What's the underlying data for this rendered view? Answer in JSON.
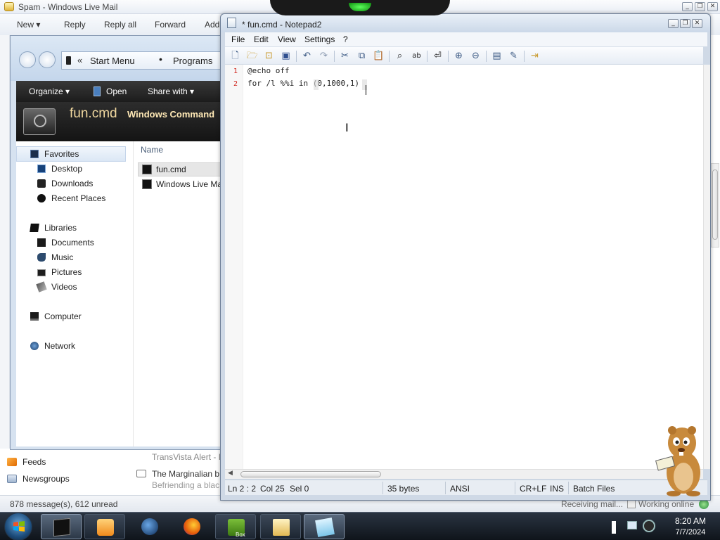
{
  "wlm": {
    "title": "Spam - Windows Live Mail",
    "toolbar": [
      "New ▾",
      "Reply",
      "Reply all",
      "Forward",
      "Add"
    ],
    "folders": [
      {
        "label": "Feeds",
        "icon": "rss-icon"
      },
      {
        "label": "Newsgroups",
        "icon": "newsgroup-icon"
      }
    ],
    "messages": [
      {
        "from": "TransVista Alert - I"
      },
      {
        "from": "The Marginalian b",
        "preview": "Befriending a blac"
      }
    ],
    "status_left": "878 message(s), 612 unread",
    "status_receiving": "Receiving mail...",
    "status_online": "Working online"
  },
  "explorer": {
    "breadcrumb": {
      "chevrons": "«",
      "parts": [
        "Start Menu",
        "Programs"
      ]
    },
    "commands": [
      "Organize ▾",
      "Open",
      "Share with ▾"
    ],
    "header": {
      "filename": "fun.cmd",
      "filetype": "Windows Command"
    },
    "nav": {
      "favorites": "Favorites",
      "favorites_items": [
        "Desktop",
        "Downloads",
        "Recent Places"
      ],
      "libraries": "Libraries",
      "libraries_items": [
        "Documents",
        "Music",
        "Pictures",
        "Videos"
      ],
      "computer": "Computer",
      "network": "Network"
    },
    "column_header": "Name",
    "files": [
      "fun.cmd",
      "Windows Live Ma"
    ]
  },
  "notepad": {
    "title": "* fun.cmd - Notepad2",
    "menu": [
      "File",
      "Edit",
      "View",
      "Settings",
      "?"
    ],
    "lines": [
      {
        "num": "1",
        "text": "@echo off"
      },
      {
        "num": "2",
        "text": "for /l %%i in (0,1000,1)"
      }
    ],
    "status": {
      "position": "Ln 2 : 2",
      "column": "Col 25",
      "selection": "Sel 0",
      "size": "35 bytes",
      "encoding": "ANSI",
      "eol": "CR+LF",
      "mode": "INS",
      "scheme": "Batch Files"
    }
  },
  "taskbar": {
    "apps": [
      {
        "name": "command-prompt",
        "active": true
      },
      {
        "name": "media-player",
        "active": false
      },
      {
        "name": "globe-app",
        "active": false
      },
      {
        "name": "firefox",
        "active": false
      },
      {
        "name": "gopher-box",
        "active": false,
        "label": "Box"
      },
      {
        "name": "explorer",
        "active": false
      },
      {
        "name": "notepad",
        "active": true
      }
    ],
    "time": "8:20 AM",
    "date": "7/7/2024"
  }
}
